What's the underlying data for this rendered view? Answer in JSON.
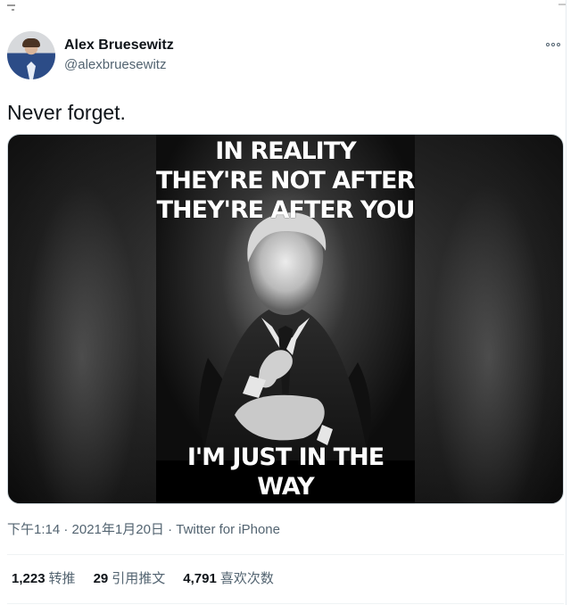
{
  "tweet": {
    "author_name": "Alex Bruesewitz",
    "author_handle": "@alexbruesewitz",
    "text": "Never forget.",
    "timestamp": "下午1:14 · 2021年1月20日 · ",
    "source": "Twitter for iPhone",
    "image": {
      "headline_lines": [
        "IN REALITY",
        "THEY'RE NOT AFTER ME",
        "THEY'RE AFTER YOU"
      ],
      "footer": "I'M JUST IN THE WAY"
    },
    "stats": [
      {
        "count": "1,223",
        "label": "转推"
      },
      {
        "count": "29",
        "label": "引用推文"
      },
      {
        "count": "4,791",
        "label": "喜欢次数"
      }
    ]
  },
  "colors": {
    "text_primary": "#0f1419",
    "text_secondary": "#536471",
    "border": "#cfd9de"
  },
  "icons": {
    "more": "more-options-icon"
  }
}
